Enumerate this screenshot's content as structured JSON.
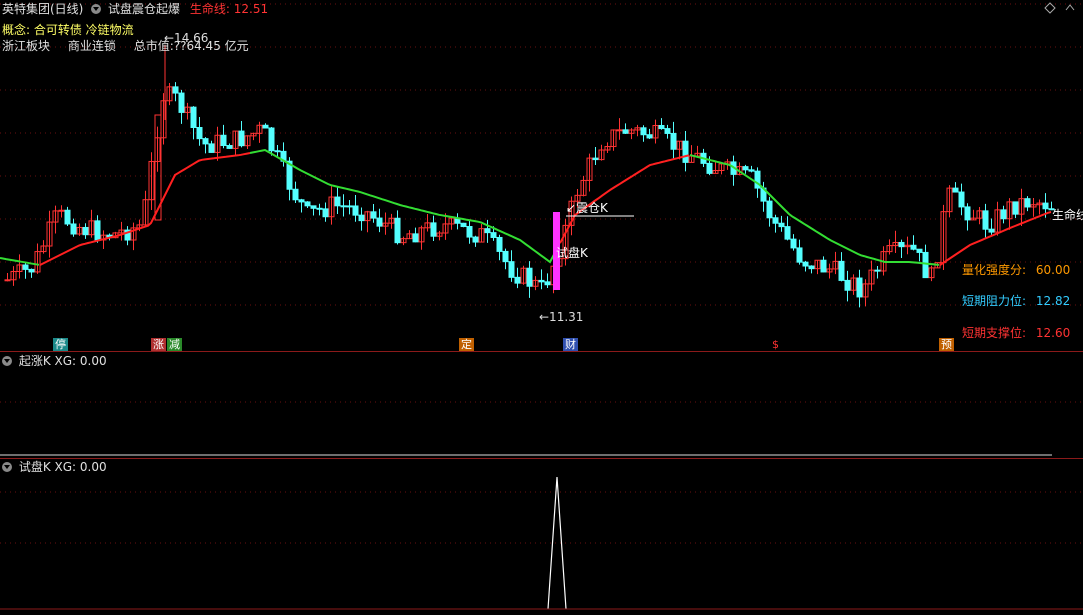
{
  "header": {
    "stock_name": "英特集团(日线)",
    "indicator_name": "试盘震仓起爆",
    "lifeline_label": "生命线: 12.51",
    "concept_line": "概念: 合可转债 冷链物流",
    "info_row": [
      "浙江板块",
      "商业连锁",
      "总市值:??64.45 亿元"
    ]
  },
  "annotations": {
    "high_price": "←14.66",
    "low_price": "←11.31",
    "zhencang": "↙震仓K",
    "shipan": "试盘K",
    "lifeline_tag": "生命线"
  },
  "score_panel": [
    {
      "label": "量化强度分:",
      "value": "60.00",
      "color": "#ff9900"
    },
    {
      "label": "短期阻力位:",
      "value": "12.82",
      "color": "#33ccff"
    },
    {
      "label": "短期支撑位:",
      "value": "12.60",
      "color": "#ff3333"
    }
  ],
  "markers": [
    {
      "text": "停",
      "bg": "#1a8a8a"
    },
    {
      "text": "涨",
      "bg": "#b03030"
    },
    {
      "text": "减",
      "bg": "#2a8a2a"
    },
    {
      "text": "定",
      "bg": "#c06000"
    },
    {
      "text": "财",
      "bg": "#3050b0"
    },
    {
      "text": "$",
      "bg": "#000000",
      "fg": "#ff3333"
    },
    {
      "text": "预",
      "bg": "#c06000"
    }
  ],
  "sub_panel_1": {
    "title": "起涨K",
    "xg": "XG: 0.00"
  },
  "sub_panel_2": {
    "title": "试盘K",
    "xg": "XG: 0.00"
  },
  "colors": {
    "up": "#ff3333",
    "down": "#54ffff",
    "lifeline_red": "#ff2020",
    "lifeline_green": "#33dd33",
    "magenta": "#ff33ff"
  }
}
